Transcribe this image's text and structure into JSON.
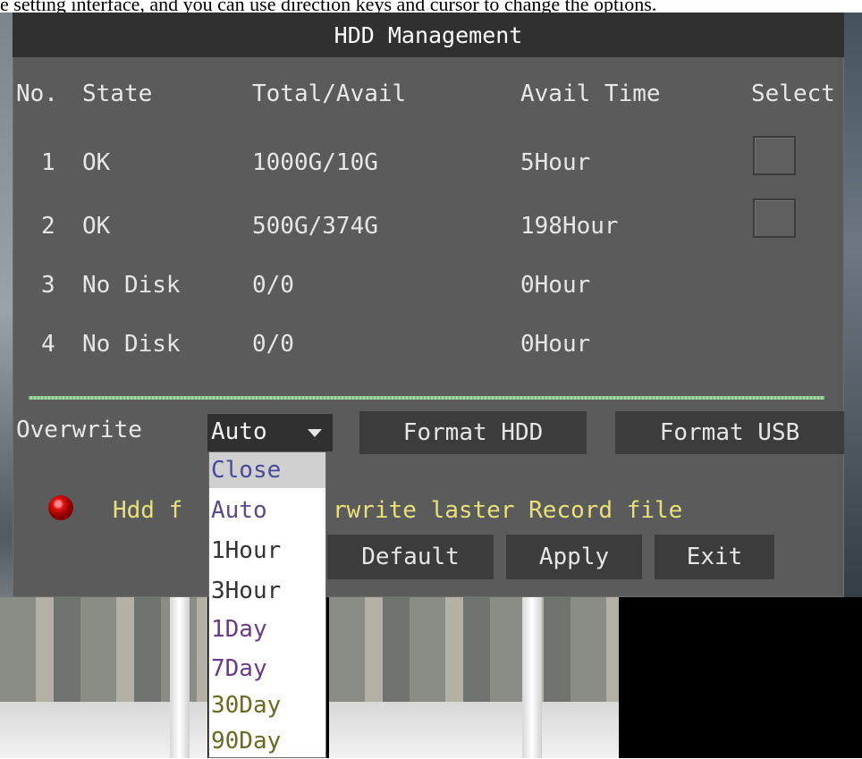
{
  "caption": "e setting interface, and you can use direction keys and cursor to change the options.",
  "title": "HDD Management",
  "table": {
    "headers": [
      "No.",
      "State",
      "Total/Avail",
      "Avail Time",
      "Select"
    ],
    "rows": [
      {
        "no": "1",
        "state": "OK",
        "total": "1000G/10G",
        "time": "5Hour",
        "has_select": true
      },
      {
        "no": "2",
        "state": "OK",
        "total": "500G/374G",
        "time": "198Hour",
        "has_select": true
      },
      {
        "no": "3",
        "state": "No Disk",
        "total": "0/0",
        "time": "0Hour",
        "has_select": false
      },
      {
        "no": "4",
        "state": "No Disk",
        "total": "0/0",
        "time": "0Hour",
        "has_select": false
      }
    ]
  },
  "overwrite": {
    "label": "Overwrite",
    "value": "Auto",
    "options": [
      "Close",
      "Auto",
      "1Hour",
      "3Hour",
      "1Day",
      "7Day",
      "30Day",
      "90Day"
    ],
    "highlighted": "Close"
  },
  "buttons": {
    "format_hdd": "Format HDD",
    "format_usb": "Format USB",
    "default": "Default",
    "apply": "Apply",
    "exit": "Exit"
  },
  "status": {
    "msg_left": "Hdd f",
    "msg_right": "rwrite laster Record file",
    "led_color": "#e01010"
  },
  "colors": {
    "panel": "#5b5b5b",
    "title_bar": "#303030",
    "button": "#3c3c3c",
    "message": "#e8e07a"
  }
}
